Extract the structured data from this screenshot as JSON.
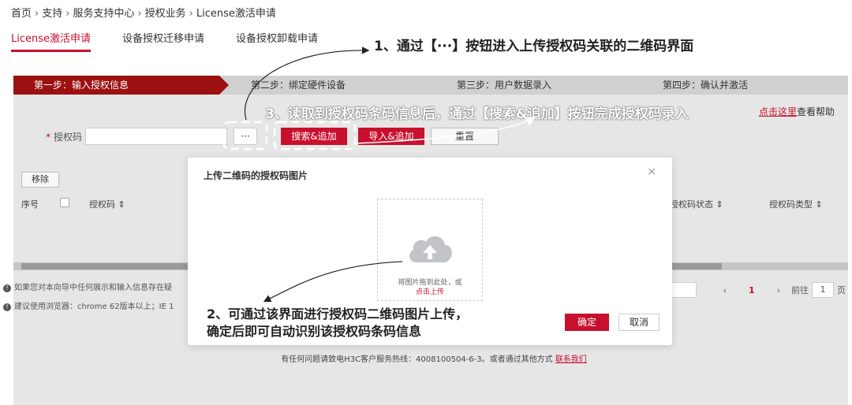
{
  "breadcrumb": {
    "items": [
      "首页",
      "支持",
      "服务支持中心",
      "授权业务",
      "License激活申请"
    ],
    "separator": "›"
  },
  "tabs": [
    {
      "label": "License激活申请",
      "active": true
    },
    {
      "label": "设备授权迁移申请",
      "active": false
    },
    {
      "label": "设备授权卸载申请",
      "active": false
    }
  ],
  "steps": [
    {
      "label": "第一步：输入授权信息",
      "active": true
    },
    {
      "label": "第二步：绑定硬件设备",
      "active": false
    },
    {
      "label": "第三步：用户数据录入",
      "active": false
    },
    {
      "label": "第四步：确认并激活",
      "active": false
    }
  ],
  "help": {
    "link": "点击这里",
    "suffix": "查看帮助"
  },
  "form": {
    "required_mark": "*",
    "label": "授权码",
    "value": "",
    "dots_button": "···",
    "search_add": "搜索&追加",
    "import_add": "导入&追加",
    "reset": "重置"
  },
  "table": {
    "remove_button": "移除",
    "headers": {
      "index": "序号",
      "code": "授权码 ⇕",
      "status": "授权码状态 ⇕",
      "type": "授权码类型 ⇕"
    }
  },
  "notes": [
    "如果您对本向导中任何展示和输入信息存在疑",
    "建议使用浏览器：chrome 62版本以上；IE 1"
  ],
  "pagination": {
    "prev": "‹",
    "current": "1",
    "next": "›",
    "goto_label": "前往",
    "goto_value": "1",
    "page_suffix": "页"
  },
  "footer": {
    "text": "有任何问题请致电H3C客户服务热线：4008100504-6-3。或者通过其他方式",
    "link": "联系我们"
  },
  "modal": {
    "title": "上传二维码的授权码图片",
    "close": "×",
    "upload_hint": "将图片拖到此处，或",
    "upload_link": "点击上传",
    "ok": "确定",
    "cancel": "取消"
  },
  "annotations": {
    "a1": "1、通过【···】按钮进入上传授权码关联的二维码界面",
    "a3": "3、读取到授权码条码信息后，通过【搜索&追加】按钮完成授权码录入",
    "a2_line1": "2、可通过该界面进行授权码二维码图片上传，",
    "a2_line2": "确定后即可自动识别该授权码条码信息"
  },
  "colors": {
    "brand_red": "#c8102e",
    "step_active": "#9b1010",
    "step_bg": "#d0d0d0",
    "backdrop": "#e6e6e6"
  },
  "icons": {
    "upload": "cloud-upload-icon",
    "close": "close-icon",
    "info": "info-icon"
  }
}
